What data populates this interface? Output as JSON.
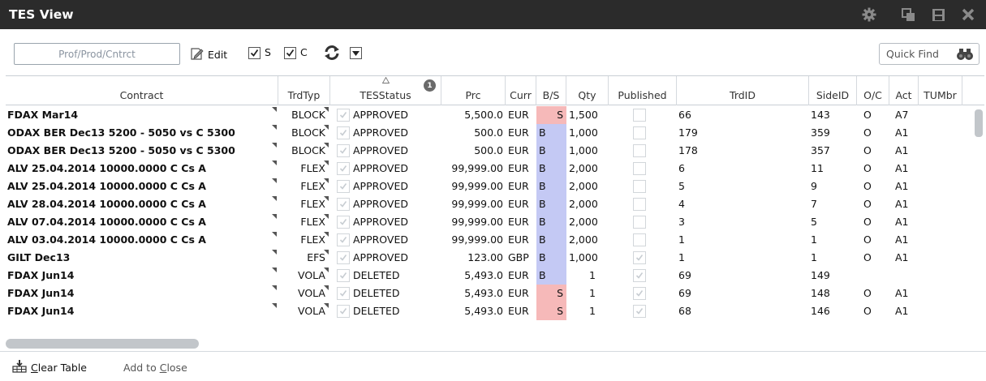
{
  "window": {
    "title": "TES View"
  },
  "titlebar_icons": [
    "gear-icon",
    "restore-window-icon",
    "save-icon",
    "close-icon"
  ],
  "toolbar": {
    "search_placeholder": "Prof/Prod/Cntrct",
    "edit_label": "Edit",
    "checkbox_s": {
      "label": "S",
      "checked": true
    },
    "checkbox_c": {
      "label": "C",
      "checked": true
    },
    "quick_find_label": "Quick Find"
  },
  "table": {
    "sort_column": "TESStatus",
    "filter_badge_count": "1",
    "columns": [
      "Contract",
      "TrdTyp",
      "TESStatus",
      "Prc",
      "Curr",
      "B/S",
      "Qty",
      "Published",
      "TrdID",
      "SideID",
      "O/C",
      "Act",
      "TUMbr"
    ],
    "rows": [
      {
        "contract": "FDAX Mar14",
        "trdtyp": "BLOCK",
        "status": "APPROVED",
        "prc": "5,500.0",
        "curr": "EUR",
        "bs": "S",
        "qty": "1,500",
        "published": false,
        "trdid": "66",
        "sideid": "143",
        "oc": "O",
        "act": "A7",
        "tumbr": ""
      },
      {
        "contract": "ODAX BER Dec13 5200 - 5050 vs C 5300",
        "trdtyp": "BLOCK",
        "status": "APPROVED",
        "prc": "500.0",
        "curr": "EUR",
        "bs": "B",
        "qty": "1,000",
        "published": false,
        "trdid": "179",
        "sideid": "359",
        "oc": "O",
        "act": "A1",
        "tumbr": ""
      },
      {
        "contract": "ODAX BER Dec13 5200 - 5050 vs C 5300",
        "trdtyp": "BLOCK",
        "status": "APPROVED",
        "prc": "500.0",
        "curr": "EUR",
        "bs": "B",
        "qty": "1,000",
        "published": false,
        "trdid": "178",
        "sideid": "357",
        "oc": "O",
        "act": "A1",
        "tumbr": ""
      },
      {
        "contract": "ALV 25.04.2014 10000.0000 C Cs A",
        "trdtyp": "FLEX",
        "status": "APPROVED",
        "prc": "99,999.00",
        "curr": "EUR",
        "bs": "B",
        "qty": "2,000",
        "published": false,
        "trdid": "6",
        "sideid": "11",
        "oc": "O",
        "act": "A1",
        "tumbr": ""
      },
      {
        "contract": "ALV 25.04.2014 10000.0000 C Cs A",
        "trdtyp": "FLEX",
        "status": "APPROVED",
        "prc": "99,999.00",
        "curr": "EUR",
        "bs": "B",
        "qty": "2,000",
        "published": false,
        "trdid": "5",
        "sideid": "9",
        "oc": "O",
        "act": "A1",
        "tumbr": ""
      },
      {
        "contract": "ALV 28.04.2014 10000.0000 C Cs A",
        "trdtyp": "FLEX",
        "status": "APPROVED",
        "prc": "99,999.00",
        "curr": "EUR",
        "bs": "B",
        "qty": "2,000",
        "published": false,
        "trdid": "4",
        "sideid": "7",
        "oc": "O",
        "act": "A1",
        "tumbr": ""
      },
      {
        "contract": "ALV 07.04.2014 10000.0000 C Cs A",
        "trdtyp": "FLEX",
        "status": "APPROVED",
        "prc": "99,999.00",
        "curr": "EUR",
        "bs": "B",
        "qty": "2,000",
        "published": false,
        "trdid": "3",
        "sideid": "5",
        "oc": "O",
        "act": "A1",
        "tumbr": ""
      },
      {
        "contract": "ALV 03.04.2014 10000.0000 C Cs A",
        "trdtyp": "FLEX",
        "status": "APPROVED",
        "prc": "99,999.00",
        "curr": "EUR",
        "bs": "B",
        "qty": "2,000",
        "published": false,
        "trdid": "1",
        "sideid": "1",
        "oc": "O",
        "act": "A1",
        "tumbr": ""
      },
      {
        "contract": "GILT Dec13",
        "trdtyp": "EFS",
        "status": "APPROVED",
        "prc": "123.00",
        "curr": "GBP",
        "bs": "B",
        "qty": "1,000",
        "published": true,
        "trdid": "1",
        "sideid": "1",
        "oc": "O",
        "act": "A1",
        "tumbr": ""
      },
      {
        "contract": "FDAX Jun14",
        "trdtyp": "VOLA",
        "status": "DELETED",
        "prc": "5,493.0",
        "curr": "EUR",
        "bs": "B",
        "qty": "1",
        "published": true,
        "trdid": "69",
        "sideid": "149",
        "oc": "",
        "act": "",
        "tumbr": ""
      },
      {
        "contract": "FDAX Jun14",
        "trdtyp": "VOLA",
        "status": "DELETED",
        "prc": "5,493.0",
        "curr": "EUR",
        "bs": "S",
        "qty": "1",
        "published": true,
        "trdid": "69",
        "sideid": "148",
        "oc": "O",
        "act": "A1",
        "tumbr": ""
      },
      {
        "contract": "FDAX Jun14",
        "trdtyp": "VOLA",
        "status": "DELETED",
        "prc": "5,493.0",
        "curr": "EUR",
        "bs": "S",
        "qty": "1",
        "published": true,
        "trdid": "68",
        "sideid": "146",
        "oc": "O",
        "act": "A1",
        "tumbr": ""
      }
    ]
  },
  "footer": {
    "clear_table_label": "Clear Table",
    "add_to_close_label": "Add to Close"
  },
  "colors": {
    "titlebar": "#2b2b2b",
    "sell": "#f6b9b9",
    "buy": "#c4c9f4"
  }
}
